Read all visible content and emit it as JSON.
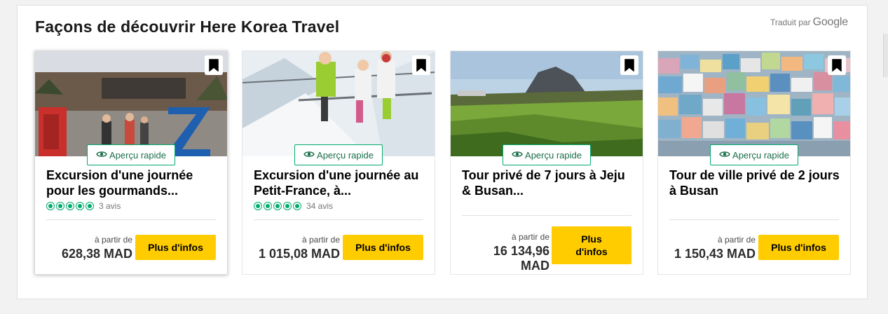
{
  "section": {
    "title": "Façons de découvrir Here Korea Travel",
    "translated_by": "Traduit par",
    "google": "Google"
  },
  "quick_view_label": "Aperçu rapide",
  "from_label": "à partir de",
  "more_info_label": "Plus d'infos",
  "cards": [
    {
      "title": "Excursion d'une journée pour les gourmands...",
      "rating": 5,
      "reviews": "3 avis",
      "price": "628,38 MAD",
      "image": "DMZ sign with visitors"
    },
    {
      "title": "Excursion d'une journée au Petit-France, à...",
      "rating": 5,
      "reviews": "34 avis",
      "price": "1 015,08 MAD",
      "image": "Family on ski lift"
    },
    {
      "title": "Tour privé de 7 jours à Jeju & Busan...",
      "rating": 0,
      "reviews": "",
      "price": "16 134,96 MAD",
      "image": "Jeju volcanic landscape"
    },
    {
      "title": "Tour de ville privé de 2 jours à Busan",
      "rating": 0,
      "reviews": "",
      "price": "1 150,43 MAD",
      "image": "Colorful hillside village"
    }
  ],
  "colors": {
    "accent_green": "#00aa6c",
    "button_yellow": "#ffcc00"
  }
}
